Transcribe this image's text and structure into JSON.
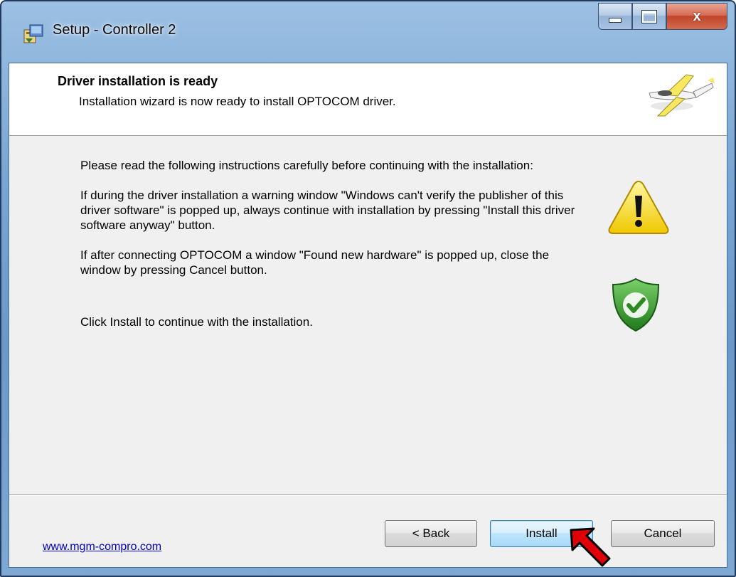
{
  "window": {
    "title": "Setup - Controller 2",
    "minimize_icon": "minimize-icon",
    "maximize_icon": "maximize-icon",
    "close_icon": "close-icon",
    "close_glyph": "x"
  },
  "header": {
    "title": "Driver installation is ready",
    "subtitle": "Installation wizard is now ready to install OPTOCOM driver.",
    "image_icon": "airplane-icon"
  },
  "content": {
    "paragraphs": [
      "Please read the following instructions carefully before continuing with the installation:",
      "If during the driver installation a warning window \"Windows can't verify the publisher of this driver software\" is popped up, always continue with installation by pressing \"Install this driver software anyway\" button.",
      "If after connecting OPTOCOM a window \"Found new hardware\" is popped up, close the window by pressing Cancel button.",
      "Click Install to continue with the installation."
    ],
    "warning_icon": "warning-icon",
    "shield_icon": "shield-check-icon"
  },
  "footer": {
    "link": "www.mgm-compro.com",
    "buttons": {
      "back": "< Back",
      "install": "Install",
      "cancel": "Cancel"
    },
    "pointer_icon": "red-arrow-pointer-icon"
  },
  "colors": {
    "link": "#0000cc",
    "arrow": "#e0000a",
    "warning_fill": "#f8e23a",
    "shield_fill": "#3a9a2e"
  }
}
